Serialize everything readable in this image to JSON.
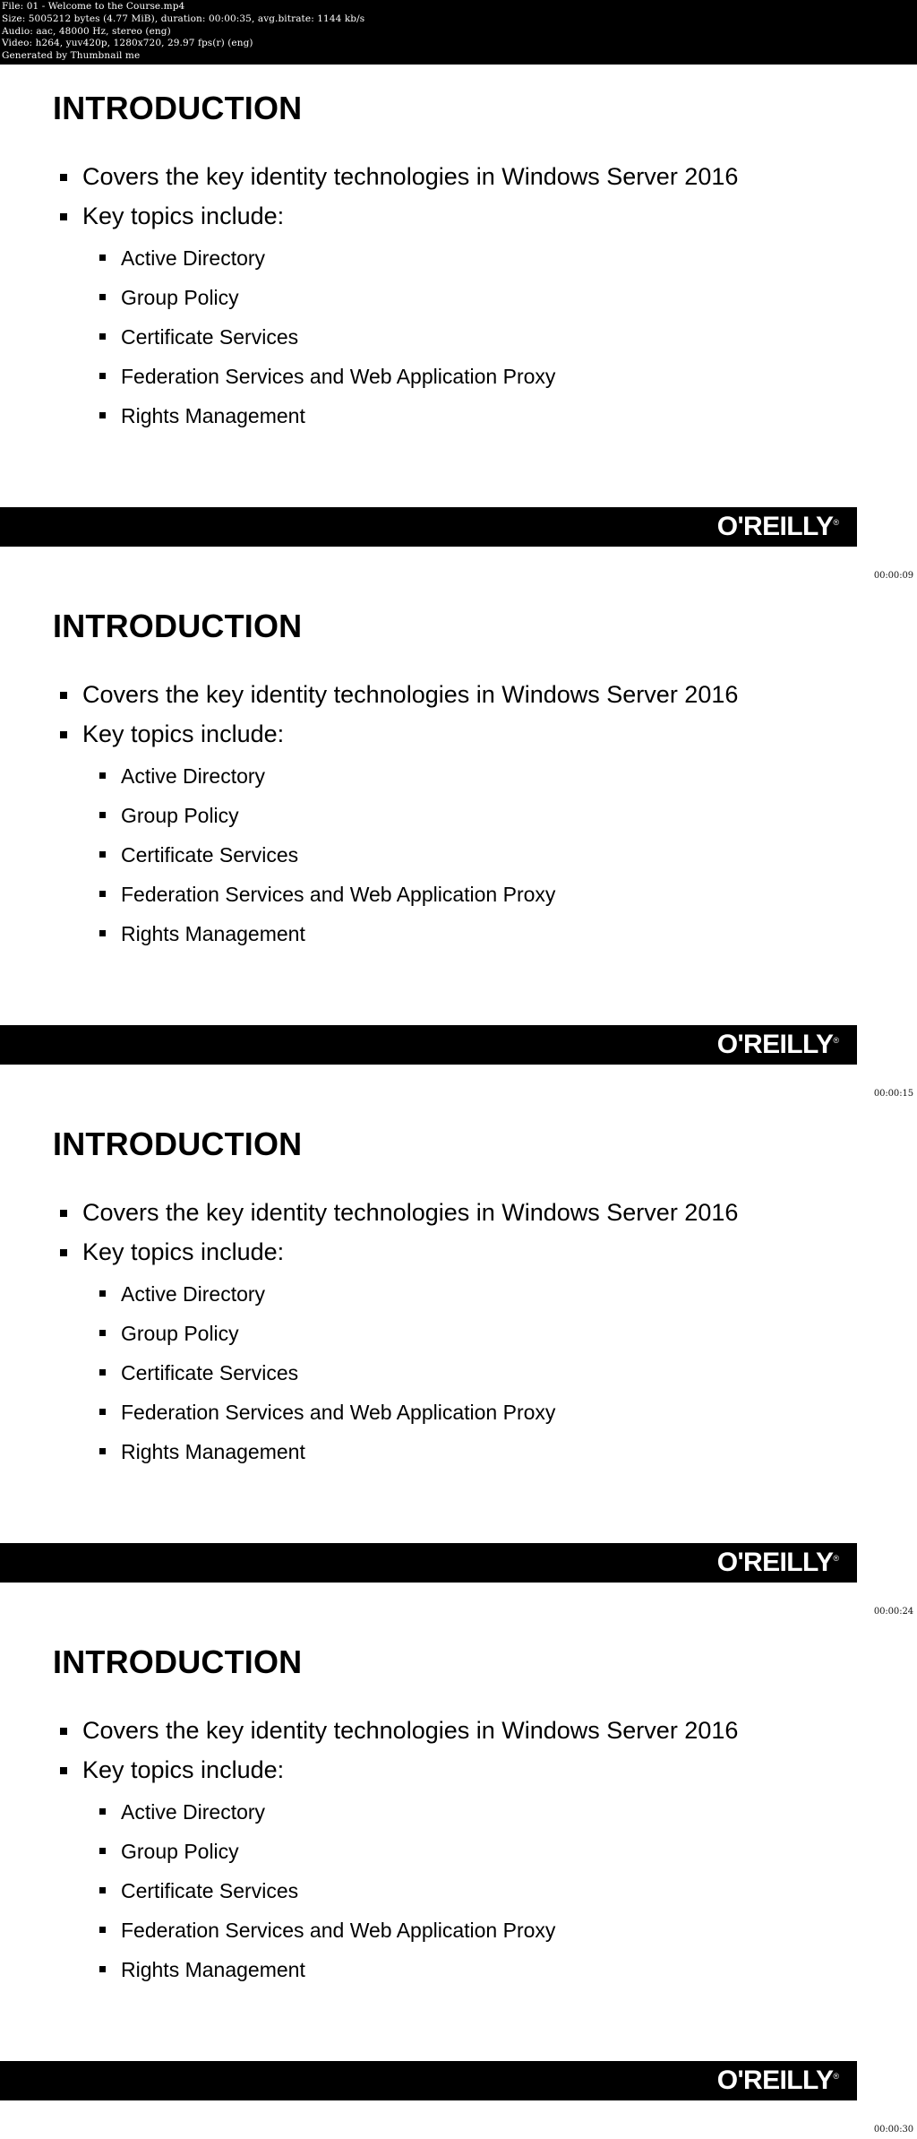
{
  "header": {
    "lines": [
      "File: 01 - Welcome to the Course.mp4",
      "Size: 5005212 bytes (4.77 MiB), duration: 00:00:35, avg.bitrate: 1144 kb/s",
      "Audio: aac, 48000 Hz, stereo (eng)",
      "Video: h264, yuv420p, 1280x720, 29.97 fps(r) (eng)",
      "Generated by Thumbnail me"
    ],
    "file_name": "01 - Welcome to the Course.mp4",
    "size_bytes": "5005212",
    "size_human": "4.77 MiB",
    "duration": "00:00:35",
    "avg_bitrate": "1144 kb/s",
    "audio_codec": "aac",
    "audio_sample_rate": "48000 Hz",
    "audio_channels": "stereo",
    "audio_language": "eng",
    "video_codec": "h264",
    "pixel_format": "yuv420p",
    "resolution": "1280x720",
    "frame_rate": "29.97 fps(r)",
    "video_language": "eng",
    "generator": "Generated by Thumbnail me"
  },
  "colors": {
    "bar_background": "#000000",
    "bar_text": "#ffffff",
    "slide_background": "#ffffff",
    "slide_text": "#000000"
  },
  "slide_template": {
    "title": "INTRODUCTION",
    "bullets": [
      "Covers the key identity technologies in Windows Server 2016",
      "Key topics include:"
    ],
    "sub_bullets": [
      "Active Directory",
      "Group Policy",
      "Certificate Services",
      "Federation Services and Web Application Proxy",
      "Rights Management"
    ],
    "logo": "O'REILLY",
    "logo_registered": "®"
  },
  "thumbnails": [
    {
      "index": 1,
      "timestamp": "00:00:09",
      "title": "INTRODUCTION",
      "bullet_1": "Covers the key identity technologies in Windows Server 2016",
      "bullet_2": "Key topics include:",
      "sub_1": "Active Directory",
      "sub_2": "Group Policy",
      "sub_3": "Certificate Services",
      "sub_4": "Federation Services and Web Application Proxy",
      "sub_5": "Rights Management",
      "logo": "O'REILLY"
    },
    {
      "index": 2,
      "timestamp": "00:00:15",
      "title": "INTRODUCTION",
      "bullet_1": "Covers the key identity technologies in Windows Server 2016",
      "bullet_2": "Key topics include:",
      "sub_1": "Active Directory",
      "sub_2": "Group Policy",
      "sub_3": "Certificate Services",
      "sub_4": "Federation Services and Web Application Proxy",
      "sub_5": "Rights Management",
      "logo": "O'REILLY"
    },
    {
      "index": 3,
      "timestamp": "00:00:24",
      "title": "INTRODUCTION",
      "bullet_1": "Covers the key identity technologies in Windows Server 2016",
      "bullet_2": "Key topics include:",
      "sub_1": "Active Directory",
      "sub_2": "Group Policy",
      "sub_3": "Certificate Services",
      "sub_4": "Federation Services and Web Application Proxy",
      "sub_5": "Rights Management",
      "logo": "O'REILLY"
    },
    {
      "index": 4,
      "timestamp": "00:00:30",
      "title": "INTRODUCTION",
      "bullet_1": "Covers the key identity technologies in Windows Server 2016",
      "bullet_2": "Key topics include:",
      "sub_1": "Active Directory",
      "sub_2": "Group Policy",
      "sub_3": "Certificate Services",
      "sub_4": "Federation Services and Web Application Proxy",
      "sub_5": "Rights Management",
      "logo": "O'REILLY"
    }
  ]
}
